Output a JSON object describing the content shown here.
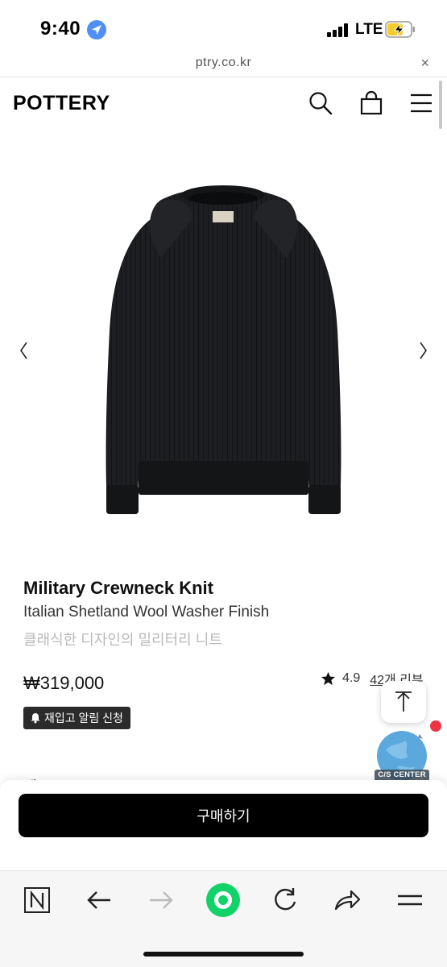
{
  "status_bar": {
    "time": "9:40",
    "network": "LTE"
  },
  "url_bar": {
    "url": "ptry.co.kr",
    "close_glyph": "×"
  },
  "header": {
    "logo": "POTTERY"
  },
  "product": {
    "name": "Military Crewneck Knit",
    "subtitle": "Italian Shetland Wool Washer Finish",
    "description": "클래식한 디자인의 밀리터리 니트",
    "price": "₩319,000",
    "rating": "4.9",
    "reviews": "42개 리뷰",
    "restock_label": "재입고 알림 신청",
    "next_section_label": "세부 Pl..."
  },
  "floating": {
    "cs_label": "C/S CENTER"
  },
  "purchase": {
    "buy_label": "구매하기"
  },
  "colors": {
    "accent_green": "#12d36a",
    "sweater": "#1b1d20",
    "cs_globe": "#5aa8dc"
  },
  "icons": [
    "location-arrow-icon",
    "signal-icon",
    "battery-charging-icon",
    "search-icon",
    "bag-icon",
    "menu-icon",
    "chevron-left-icon",
    "chevron-right-icon",
    "star-icon",
    "bell-icon",
    "scroll-top-icon",
    "naver-n-icon",
    "back-arrow-icon",
    "forward-arrow-icon",
    "green-home-icon",
    "reload-icon",
    "share-icon",
    "hamburger-icon"
  ]
}
